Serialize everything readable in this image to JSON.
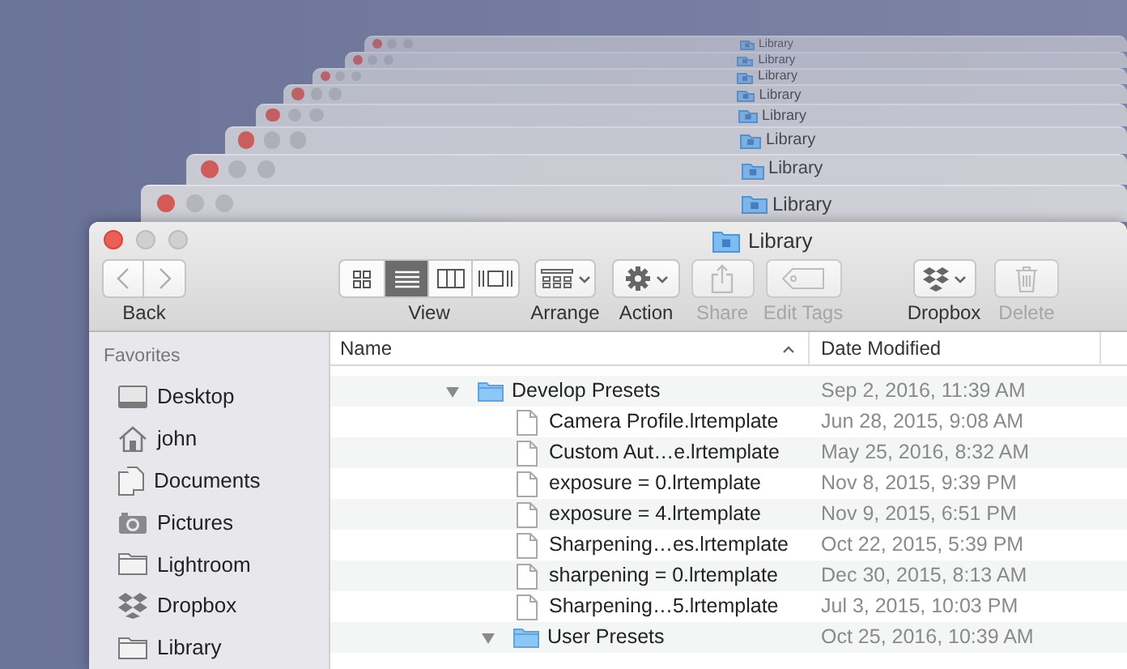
{
  "desktop_windows": [
    {
      "title": "Library"
    },
    {
      "title": "Library"
    },
    {
      "title": "Library"
    },
    {
      "title": "Library"
    },
    {
      "title": "Library"
    },
    {
      "title": "Library"
    },
    {
      "title": "Library"
    },
    {
      "title": "Library"
    }
  ],
  "window": {
    "title": "Library"
  },
  "toolbar": [
    {
      "kind": "nav",
      "label": "Back",
      "disabled": false
    },
    {
      "kind": "view",
      "label": "View",
      "disabled": false,
      "modes": [
        {
          "selected": false
        },
        {
          "selected": true
        },
        {
          "selected": false
        },
        {
          "selected": false
        }
      ]
    },
    {
      "kind": "menu",
      "label": "Arrange",
      "disabled": false
    },
    {
      "kind": "menu",
      "label": "Action",
      "disabled": false
    },
    {
      "kind": "button",
      "label": "Share",
      "disabled": true
    },
    {
      "kind": "button",
      "label": "Edit Tags",
      "disabled": true
    },
    {
      "kind": "menu",
      "label": "Dropbox",
      "disabled": false
    },
    {
      "kind": "button",
      "label": "Delete",
      "disabled": true
    }
  ],
  "sidebar": {
    "heading": "Favorites",
    "items": [
      {
        "label": "Desktop"
      },
      {
        "label": "john"
      },
      {
        "label": "Documents"
      },
      {
        "label": "Pictures"
      },
      {
        "label": "Lightroom"
      },
      {
        "label": "Dropbox"
      },
      {
        "label": "Library"
      }
    ]
  },
  "file_list": {
    "columns": [
      {
        "label": "Name",
        "sorted": true
      },
      {
        "label": "Date Modified",
        "sorted": false
      }
    ],
    "rows": [
      {
        "kind": "folder",
        "name": "Develop Presets",
        "date": "Sep 2, 2016, 11:39 AM",
        "expanded": true,
        "children": [
          {
            "kind": "file",
            "name": "Camera Profile.lrtemplate",
            "date": "Jun 28, 2015, 9:08 AM"
          },
          {
            "kind": "file",
            "name": "Custom Aut…e.lrtemplate",
            "date": "May 25, 2016, 8:32 AM"
          },
          {
            "kind": "file",
            "name": "exposure = 0.lrtemplate",
            "date": "Nov 8, 2015, 9:39 PM"
          },
          {
            "kind": "file",
            "name": "exposure = 4.lrtemplate",
            "date": "Nov 9, 2015, 6:51 PM"
          },
          {
            "kind": "file",
            "name": "Sharpening…es.lrtemplate",
            "date": "Oct 22, 2015, 5:39 PM"
          },
          {
            "kind": "file",
            "name": "sharpening = 0.lrtemplate",
            "date": "Dec 30, 2015, 8:13 AM"
          },
          {
            "kind": "file",
            "name": "Sharpening…5.lrtemplate",
            "date": "Jul 3, 2015, 10:03 PM"
          },
          {
            "kind": "folder",
            "name": "User Presets",
            "date": "Oct 25, 2016, 10:39 AM",
            "expanded": true
          }
        ]
      }
    ]
  }
}
